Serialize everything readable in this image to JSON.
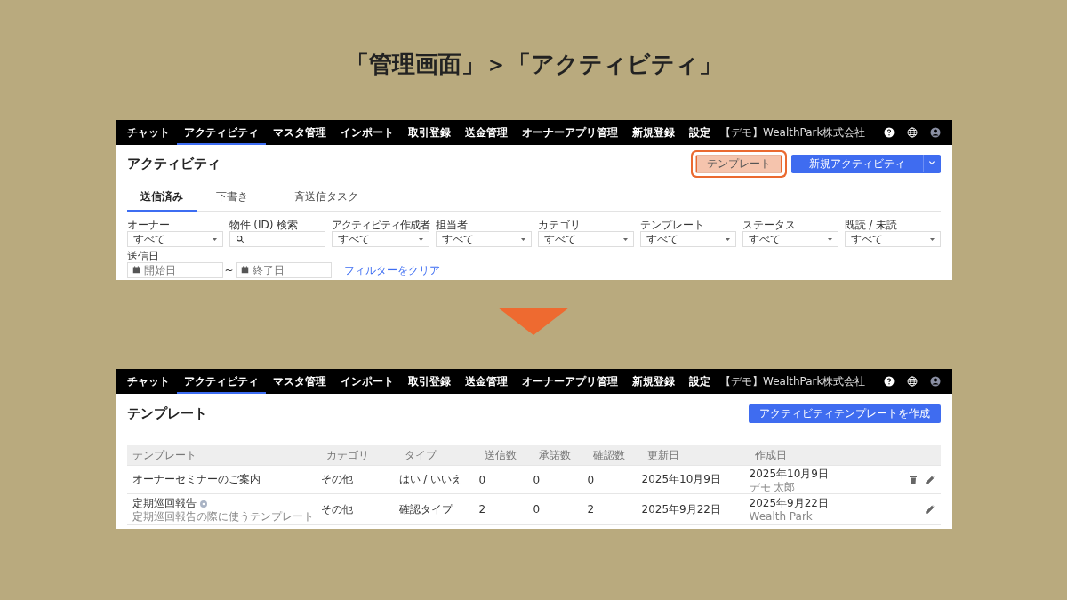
{
  "title": "「管理画面」＞「アクティビティ」",
  "screens": [
    {
      "kind": "activity_list",
      "nav": {
        "items": [
          {
            "label": "チャット",
            "selected": false
          },
          {
            "label": "アクティビティ",
            "selected": true
          },
          {
            "label": "マスタ管理",
            "selected": false
          },
          {
            "label": "インポート",
            "selected": false
          },
          {
            "label": "取引登録",
            "selected": false
          },
          {
            "label": "送金管理",
            "selected": false
          },
          {
            "label": "オーナーアプリ管理",
            "selected": false
          },
          {
            "label": "新規登録",
            "selected": false
          },
          {
            "label": "設定",
            "selected": false
          }
        ],
        "company": "【デモ】WealthPark株式会社"
      },
      "page_title": "アクティビティ",
      "buttons": [
        {
          "kind": "secondary",
          "label": "テンプレート",
          "highlighted": true
        },
        {
          "kind": "split_primary",
          "label": "新規アクティビティ",
          "highlighted": false
        }
      ],
      "tabs": [
        {
          "label": "送信済み",
          "selected": true
        },
        {
          "label": "下書き",
          "selected": false
        },
        {
          "label": "一斉送信タスク",
          "selected": false
        }
      ],
      "filters": [
        {
          "kind": "select",
          "label": "オーナー",
          "value": "すべて"
        },
        {
          "kind": "search",
          "label": "物件 (ID) 検索"
        },
        {
          "kind": "select",
          "label": "アクティビティ作成者",
          "value": "すべて"
        },
        {
          "kind": "select",
          "label": "担当者",
          "value": "すべて"
        },
        {
          "kind": "select",
          "label": "カテゴリ",
          "value": "すべて"
        },
        {
          "kind": "select",
          "label": "テンプレート",
          "value": "すべて"
        },
        {
          "kind": "select",
          "label": "ステータス",
          "value": "すべて"
        },
        {
          "kind": "select",
          "label": "既読 / 未読",
          "value": "すべて"
        }
      ],
      "date_filter": {
        "label": "送信日",
        "start_placeholder": "開始日",
        "separator": "~",
        "end_placeholder": "終了日"
      },
      "clear_link": "フィルターをクリア"
    },
    {
      "kind": "template_list",
      "nav": {
        "items": [
          {
            "label": "チャット",
            "selected": false
          },
          {
            "label": "アクティビティ",
            "selected": true
          },
          {
            "label": "マスタ管理",
            "selected": false
          },
          {
            "label": "インポート",
            "selected": false
          },
          {
            "label": "取引登録",
            "selected": false
          },
          {
            "label": "送金管理",
            "selected": false
          },
          {
            "label": "オーナーアプリ管理",
            "selected": false
          },
          {
            "label": "新規登録",
            "selected": false
          },
          {
            "label": "設定",
            "selected": false
          }
        ],
        "company": "【デモ】WealthPark株式会社"
      },
      "page_title": "テンプレート",
      "buttons": [
        {
          "kind": "primary",
          "label": "アクティビティテンプレートを作成",
          "highlighted": false
        }
      ],
      "table": {
        "columns": [
          "テンプレート",
          "カテゴリ",
          "タイプ",
          "送信数",
          "承諾数",
          "確認数",
          "更新日",
          "作成日"
        ],
        "rows": [
          {
            "cells": [
              "オーナーセミナーのご案内",
              "その他",
              "はい / いいえ",
              "0",
              "0",
              "0",
              "2025年10月9日",
              "2025年10月9日"
            ],
            "has_help": false,
            "creator": "デモ 太郎",
            "deletable": true
          },
          {
            "cells": [
              "定期巡回報告",
              "その他",
              "確認タイプ",
              "2",
              "0",
              "2",
              "2025年9月22日",
              "2025年9月22日"
            ],
            "has_help": true,
            "description": "定期巡回報告の際に使うテンプレート",
            "creator": "Wealth Park",
            "deletable": false
          }
        ]
      }
    }
  ]
}
